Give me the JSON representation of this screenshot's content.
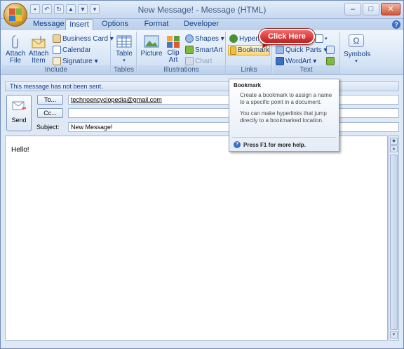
{
  "window": {
    "title": "New Message! - Message (HTML)"
  },
  "quick_access": [
    "save-icon",
    "undo-icon",
    "redo-icon",
    "up-icon",
    "down-icon",
    "customize-icon"
  ],
  "tabs": [
    "Message",
    "Insert",
    "Options",
    "Format Text",
    "Developer"
  ],
  "active_tab": "Insert",
  "ribbon": {
    "include": {
      "label": "Include",
      "attach_file": "Attach File",
      "attach_item": "Attach Item",
      "business_card": "Business Card ▾",
      "calendar": "Calendar",
      "signature": "Signature ▾"
    },
    "tables": {
      "label": "Tables",
      "table": "Table"
    },
    "illustrations": {
      "label": "Illustrations",
      "picture": "Picture",
      "clip_art": "Clip Art",
      "shapes": "Shapes ▾",
      "smartart": "SmartArt",
      "chart": "Chart"
    },
    "links": {
      "label": "Links",
      "hyperlink": "Hyperl",
      "bookmark": "Bookmark"
    },
    "text": {
      "label": "Text",
      "quick_parts": "Quick Parts ▾",
      "wordart": "WordArt ▾"
    },
    "symbols": {
      "label": "Symbols",
      "symbols": "Symbols"
    }
  },
  "callout": "Click Here",
  "infobar": "This message has not been sent.",
  "compose": {
    "send": "Send",
    "to_button": "To...",
    "cc_button": "Cc...",
    "subject_label": "Subject:",
    "to_value": "technoencyclopedia@gmail.com",
    "cc_value": "",
    "subject_value": "New Message!",
    "body": "Hello!"
  },
  "tooltip": {
    "title": "Bookmark",
    "p1": "Create a bookmark to assign a name to a specific point in a document.",
    "p2": "You can make hyperlinks that jump directly to a bookmarked location.",
    "footer": "Press F1 for more help."
  },
  "colors": {
    "accent": "#15428b",
    "callout": "#c31d1d"
  }
}
